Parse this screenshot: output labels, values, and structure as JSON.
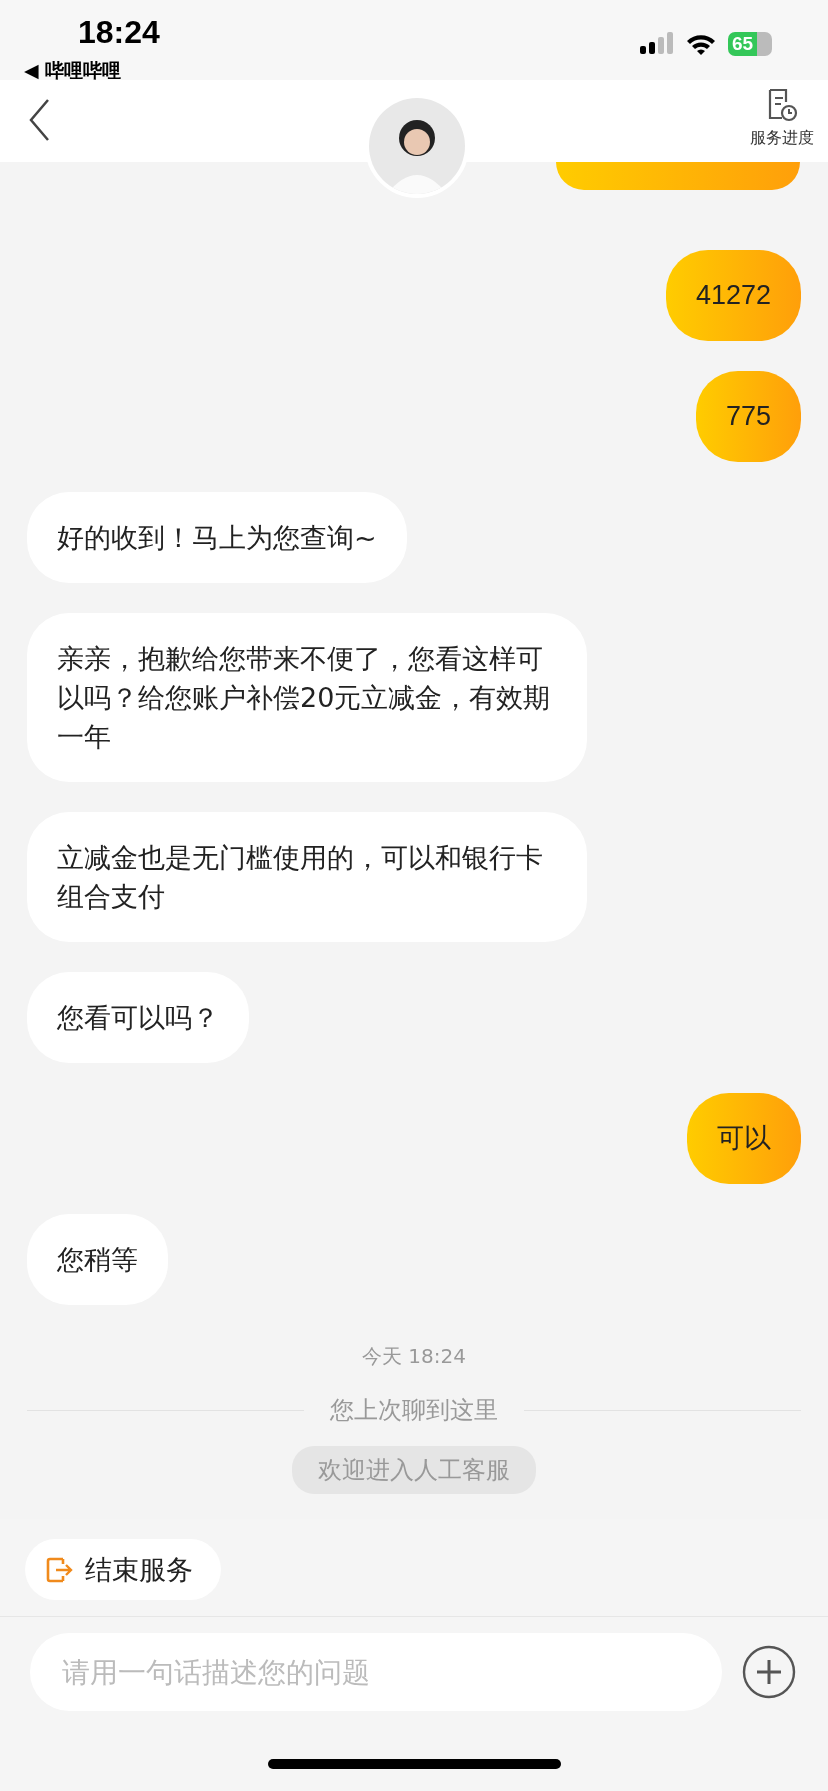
{
  "status_bar": {
    "time": "18:24",
    "back_app": "◀ 哔哩哔哩",
    "battery": "65"
  },
  "header": {
    "service_progress": "服务进度"
  },
  "messages": [
    {
      "kind": "outgoing",
      "text": "41272"
    },
    {
      "kind": "outgoing",
      "text": "775"
    },
    {
      "kind": "incoming",
      "text": "好的收到！马上为您查询~"
    },
    {
      "kind": "incoming",
      "text": "亲亲，抱歉给您带来不便了，您看这样可以吗？给您账户补偿20元立减金，有效期一年"
    },
    {
      "kind": "incoming",
      "text": "立减金也是无门槛使用的，可以和银行卡组合支付"
    },
    {
      "kind": "incoming",
      "text": "您看可以吗？"
    },
    {
      "kind": "outgoing",
      "text": "可以"
    },
    {
      "kind": "incoming",
      "text": "您稍等"
    }
  ],
  "timestamp": "今天 18:24",
  "divider": "您上次聊到这里",
  "system_notice": "欢迎进入人工客服",
  "quick_action": "结束服务",
  "input": {
    "placeholder": "请用一句话描述您的问题"
  }
}
